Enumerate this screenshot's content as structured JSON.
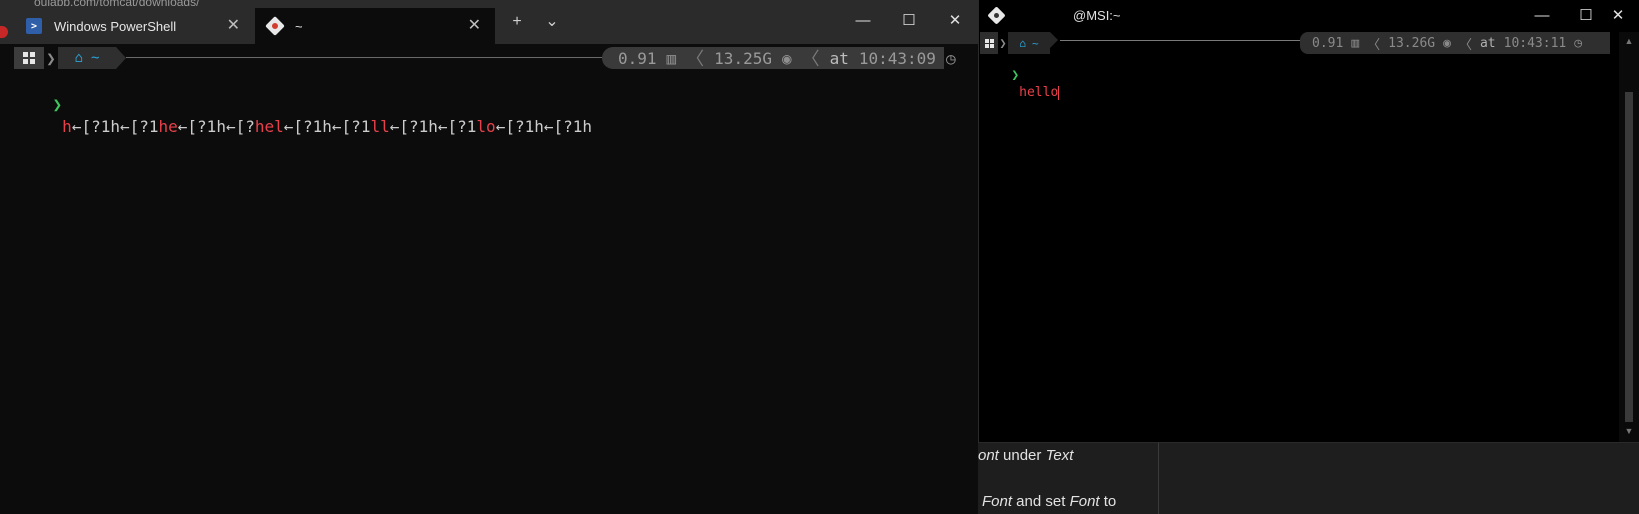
{
  "background": {
    "peek_text": "ouiapp.com/tomcat/downloads/"
  },
  "terminal": {
    "tabs": [
      {
        "label": "Windows PowerShell",
        "icon": "powershell-icon",
        "active": false
      },
      {
        "label": "~",
        "icon": "git-bash-icon",
        "active": true
      }
    ],
    "new_tab": "+",
    "dropdown": "⌄",
    "window_controls": {
      "minimize": "—",
      "maximize": "☐",
      "close": "✕"
    },
    "prompt": {
      "path": "~",
      "load": "0.91",
      "memory": "13.25G",
      "time_prefix": "at",
      "time": "10:43:09"
    },
    "input": {
      "arrow": "❯",
      "segments": [
        {
          "text": "h",
          "color": "red"
        },
        {
          "text": "←[?1h←[?1",
          "color": "white"
        },
        {
          "text": "he",
          "color": "red"
        },
        {
          "text": "←[?1h←[?",
          "color": "white"
        },
        {
          "text": "hel",
          "color": "red"
        },
        {
          "text": "←[?1h←[?1",
          "color": "white"
        },
        {
          "text": "ll",
          "color": "red"
        },
        {
          "text": "←[?1h←[?1",
          "color": "white"
        },
        {
          "text": "lo",
          "color": "red"
        },
        {
          "text": "←[?1h←[?1h",
          "color": "white"
        }
      ]
    }
  },
  "mintty": {
    "title": "@MSI:~",
    "window_controls": {
      "minimize": "—",
      "maximize": "☐",
      "close": "✕"
    },
    "prompt": {
      "path": "~",
      "load": "0.91",
      "memory": "13.26G",
      "time_prefix": "at",
      "time": "10:43:11"
    },
    "input": {
      "arrow": "❯",
      "text": "hello"
    }
  },
  "document": {
    "line1_italic_a": "ont",
    "line1_text": " under ",
    "line1_italic_b": "Text",
    "line2_italic_a": "Font",
    "line2_text": " and set ",
    "line2_italic_b": "Font",
    "line2_tail": " to"
  },
  "colors": {
    "prompt_arrow": "#3fc55e",
    "typed_text": "#e8404a",
    "path_blue": "#2ba4d8"
  }
}
